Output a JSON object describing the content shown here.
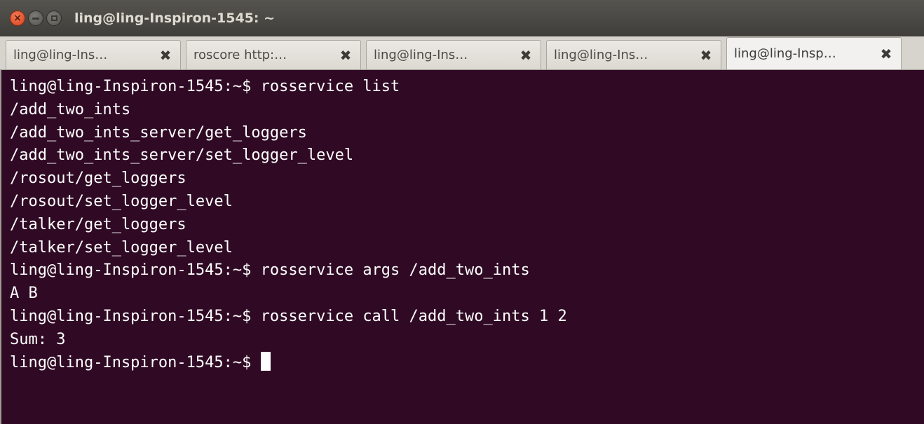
{
  "window": {
    "title": "ling@ling-Inspiron-1545: ~"
  },
  "tabs": [
    {
      "label": "ling@ling-Ins…",
      "active": false
    },
    {
      "label": "roscore http:…",
      "active": false
    },
    {
      "label": "ling@ling-Ins…",
      "active": false
    },
    {
      "label": "ling@ling-Ins…",
      "active": false
    },
    {
      "label": "ling@ling-Insp…",
      "active": true
    }
  ],
  "terminal": {
    "lines": [
      "ling@ling-Inspiron-1545:~$ rosservice list",
      "/add_two_ints",
      "/add_two_ints_server/get_loggers",
      "/add_two_ints_server/set_logger_level",
      "/rosout/get_loggers",
      "/rosout/set_logger_level",
      "/talker/get_loggers",
      "/talker/set_logger_level",
      "ling@ling-Inspiron-1545:~$ rosservice args /add_two_ints",
      "A B",
      "ling@ling-Inspiron-1545:~$ rosservice call /add_two_ints 1 2",
      "Sum: 3"
    ],
    "prompt": "ling@ling-Inspiron-1545:~$ "
  },
  "colors": {
    "terminal_bg": "#300a24",
    "terminal_fg": "#ffffff",
    "titlebar_bg": "#3f3e3a",
    "close_button": "#e0542c"
  },
  "icons": {
    "close": "close-icon",
    "minimize": "minimize-icon",
    "maximize": "maximize-icon",
    "tab_close": "tab-close-icon"
  }
}
